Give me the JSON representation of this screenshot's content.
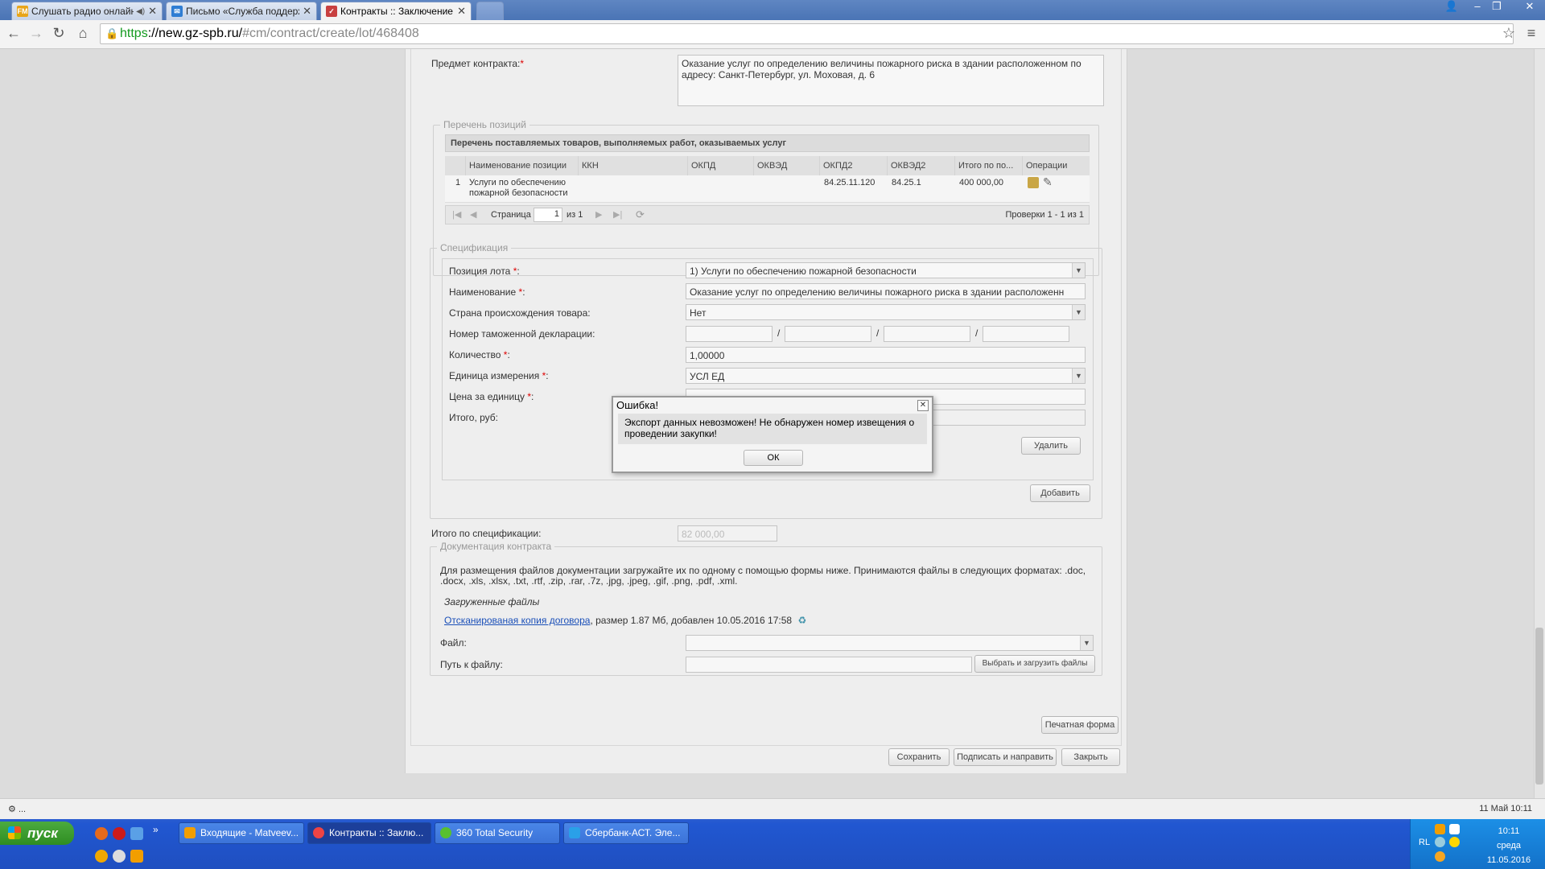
{
  "browser": {
    "tabs": [
      {
        "label": "Слушать радио онлайн",
        "active": false
      },
      {
        "label": "Письмо «Служба поддерж",
        "active": false
      },
      {
        "label": "Контракты :: Заключение",
        "active": true
      }
    ],
    "url_scheme": "https",
    "url_host": "://new.gz-spb.ru/",
    "url_path": "#cm/contract/create/lot/468408"
  },
  "form": {
    "subject_label": "Предмет контракта:",
    "subject_value": "Оказание услуг по определению величины пожарного риска в здании расположенном по адресу: Санкт-Петербург, ул. Моховая, д. 6",
    "positions": {
      "legend": "Перечень позиций",
      "title": "Перечень поставляемых товаров, выполняемых работ, оказываемых услуг",
      "columns": [
        "Наименование позиции",
        "ККН",
        "ОКПД",
        "ОКВЭД",
        "ОКПД2",
        "ОКВЭД2",
        "Итого по по...",
        "Операции"
      ],
      "rows": [
        {
          "num": "1",
          "name_line1": "Услуги по обеспечению",
          "name_line2": "пожарной безопасности",
          "okpd2": "84.25.11.120",
          "okved2": "84.25.1",
          "total": "400 000,00"
        }
      ],
      "pager_page_label": "Страница",
      "pager_page": "1",
      "pager_of": "из 1",
      "pager_info": "Проверки 1 - 1 из 1"
    },
    "spec": {
      "legend": "Спецификация",
      "lot_position_label": "Позиция лота",
      "lot_position_value": "1) Услуги по обеспечению пожарной безопасности",
      "name_label": "Наименование",
      "name_value": "Оказание услуг по определению величины пожарного риска в здании расположенн",
      "country_label": "Страна происхождения товара:",
      "country_value": "Нет",
      "customs_label": "Номер таможенной декларации:",
      "quantity_label": "Количество",
      "quantity_value": "1,00000",
      "unit_label": "Единица измерения",
      "unit_value": "УСЛ ЕД",
      "price_label": "Цена за единицу",
      "total_label": "Итого, руб:",
      "delete_button": "Удалить",
      "add_button": "Добавить"
    },
    "spec_total_label": "Итого по спецификации:",
    "spec_total_value": "82 000,00",
    "docs": {
      "legend": "Документация контракта",
      "hint": "Для размещения файлов документации загружайте их по одному с помощью формы ниже. Принимаются файлы в следующих форматах: .doc, .docx, .xls, .xlsx, .txt, .rtf, .zip, .rar, .7z, .jpg, .jpeg, .gif, .png, .pdf, .xml.",
      "uploaded_title": "Загруженные файлы",
      "file_link": "Отсканированая копия договора",
      "file_meta": ", размер 1.87 Мб, добавлен 10.05.2016 17:58",
      "file_label": "Файл:",
      "path_label": "Путь к файлу:",
      "choose_button": "Выбрать и загрузить файлы"
    },
    "print_button": "Печатная форма",
    "save_button": "Сохранить",
    "sign_button": "Подписать и направить",
    "close_button": "Закрыть"
  },
  "dialog": {
    "title": "Ошибка!",
    "message": "Экспорт данных невозможен! Не обнаружен номер извещения о проведении закупки!",
    "ok_button": "ОК"
  },
  "status": {
    "left": "...",
    "right": "11 Май 10:11"
  },
  "taskbar": {
    "start_label": "пуск",
    "tasks": [
      {
        "label": "Входящие - Matveev...",
        "active": false
      },
      {
        "label": "Контракты :: Заклю...",
        "active": true
      },
      {
        "label": "360 Total Security",
        "active": false
      },
      {
        "label": "Сбербанк-АСТ. Эле...",
        "active": false
      }
    ],
    "lang": "RL",
    "time": "10:11",
    "weekday": "среда",
    "date": "11.05.2016"
  },
  "colors": {
    "accent_link": "#1a4fb8",
    "required": "#dd0000",
    "xp_blue": "#2157d1"
  }
}
